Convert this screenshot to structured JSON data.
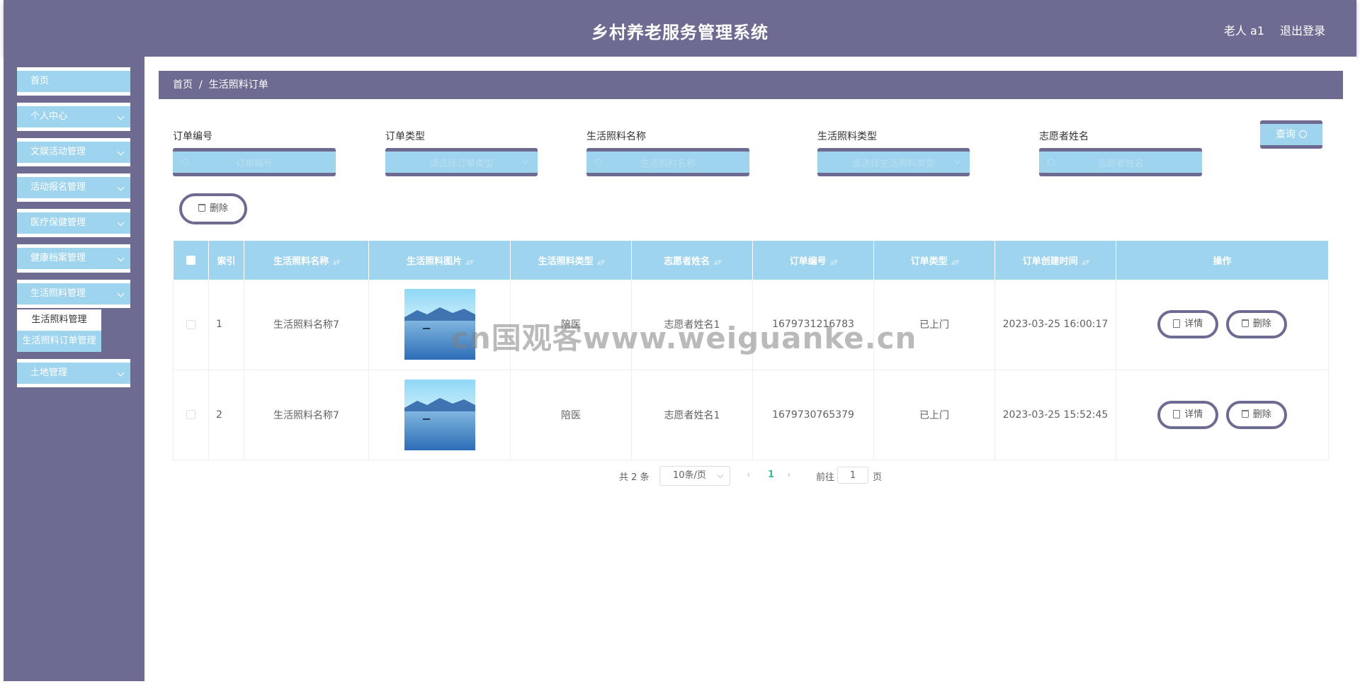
{
  "header": {
    "title": "乡村养老服务管理系统",
    "user": "老人 a1",
    "logout": "退出登录"
  },
  "sidebar": {
    "items": [
      {
        "label": "首页",
        "has_arrow": false
      },
      {
        "label": "个人中心",
        "has_arrow": true
      },
      {
        "label": "文娱活动管理",
        "has_arrow": true
      },
      {
        "label": "活动报名管理",
        "has_arrow": true
      },
      {
        "label": "医疗保健管理",
        "has_arrow": true
      },
      {
        "label": "健康档案管理",
        "has_arrow": true
      },
      {
        "label": "生活照料管理",
        "has_arrow": true
      },
      {
        "label": "土地管理",
        "has_arrow": true
      }
    ],
    "submenu": [
      "生活照料管理",
      "生活照料订单管理"
    ]
  },
  "breadcrumb": {
    "home": "首页",
    "separator": "/",
    "current": "生活照料订单"
  },
  "filters": [
    {
      "label": "订单编号",
      "placeholder": "订单编号",
      "kind": "input"
    },
    {
      "label": "订单类型",
      "placeholder": "请选择订单类型",
      "kind": "select"
    },
    {
      "label": "生活照料名称",
      "placeholder": "生活照料名称",
      "kind": "input"
    },
    {
      "label": "生活照料类型",
      "placeholder": "请选择生活照料类型",
      "kind": "select"
    },
    {
      "label": "志愿者姓名",
      "placeholder": "志愿者姓名",
      "kind": "input"
    }
  ],
  "query_button": "查询",
  "delete_button": "删除",
  "table": {
    "columns": [
      "索引",
      "生活照料名称",
      "生活照料图片",
      "生活照料类型",
      "志愿者姓名",
      "订单编号",
      "订单类型",
      "订单创建时间",
      "操作"
    ],
    "rows": [
      {
        "index": "1",
        "name": "生活照料名称7",
        "type": "陪医",
        "volunteer": "志愿者姓名1",
        "order_no": "1679731216783",
        "order_type": "已上门",
        "created": "2023-03-25 16:00:17"
      },
      {
        "index": "2",
        "name": "生活照料名称7",
        "type": "陪医",
        "volunteer": "志愿者姓名1",
        "order_no": "1679730765379",
        "order_type": "已上门",
        "created": "2023-03-25 15:52:45"
      }
    ],
    "row_actions": {
      "detail": "详情",
      "delete": "删除"
    }
  },
  "pagination": {
    "total": "共 2 条",
    "page_size": "10条/页",
    "current_page": "1",
    "goto_prefix": "前往",
    "goto_value": "1",
    "goto_suffix": "页"
  },
  "watermark": "cn国观客www.weiguanke.cn",
  "colors": {
    "theme": "#6e6b92",
    "accent": "#9fd4ee",
    "pager_active": "#2ebf91"
  }
}
